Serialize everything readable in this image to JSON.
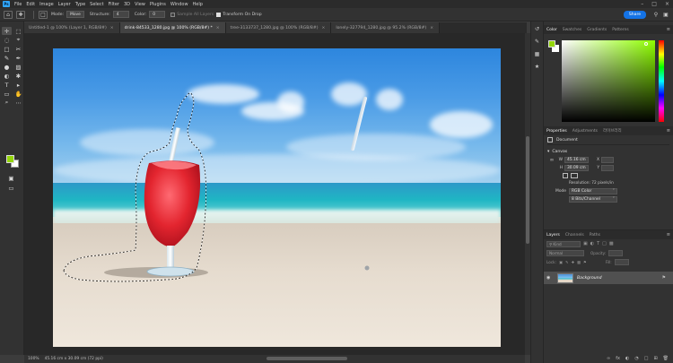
{
  "menubar": {
    "logo": "Ps",
    "items": [
      "File",
      "Edit",
      "Image",
      "Layer",
      "Type",
      "Select",
      "Filter",
      "3D",
      "View",
      "Plugins",
      "Window",
      "Help"
    ]
  },
  "options": {
    "mode_label": "Mode:",
    "mode_value": "Move",
    "structure_label": "Structure:",
    "structure_value": "4",
    "color_label": "Color:",
    "color_value": "0",
    "sample_all_layers": "Sample All Layers",
    "transform_on_drop": "Transform On Drop",
    "share_label": "Share"
  },
  "tabs": [
    {
      "label": "Untitled-1 @ 100% (Layer 1, RGB/8#)",
      "active": false
    },
    {
      "label": "drink-84533_1280.jpg @ 100% (RGB/8#) *",
      "active": true
    },
    {
      "label": "tree-3133737_1280.jpg @ 100% (RGB/8#)",
      "active": false
    },
    {
      "label": "lonely-327794_1280.jpg @ 95.2% (RGB/8#)",
      "active": false
    }
  ],
  "status": {
    "zoom": "100%",
    "dimensions": "45.16 cm x 30.09 cm (72 ppi)"
  },
  "color_panel": {
    "tabs": [
      "Color",
      "Swatches",
      "Gradients",
      "Patterns"
    ],
    "foreground": "#94d60a",
    "background": "#ffffff"
  },
  "properties": {
    "tabs": [
      "Properties",
      "Adjustments",
      "라이브러리"
    ],
    "doc_label": "Document",
    "canvas_title": "Canvas",
    "w_label": "W",
    "w_value": "45.16 cm",
    "h_label": "H",
    "h_value": "30.09 cm",
    "x_label": "X",
    "y_label": "Y",
    "resolution": "Resolution: 72 pixels/in",
    "mode_label": "Mode",
    "mode_value": "RGB Color",
    "depth_value": "8 Bits/Channel"
  },
  "layers": {
    "tabs": [
      "Layers",
      "Channels",
      "Paths"
    ],
    "kind_label": "Kind",
    "blend_mode": "Normal",
    "opacity_label": "Opacity:",
    "lock_label": "Lock:",
    "fill_label": "Fill:",
    "layer_name": "Background"
  },
  "tools": [
    "✛",
    "⬚",
    "◌",
    "⌖",
    "□",
    "✂",
    "✎",
    "✒",
    "●",
    "▨",
    "◐",
    "✱",
    "T",
    "▸",
    "▭",
    "✋",
    "⌕",
    "⋯"
  ]
}
